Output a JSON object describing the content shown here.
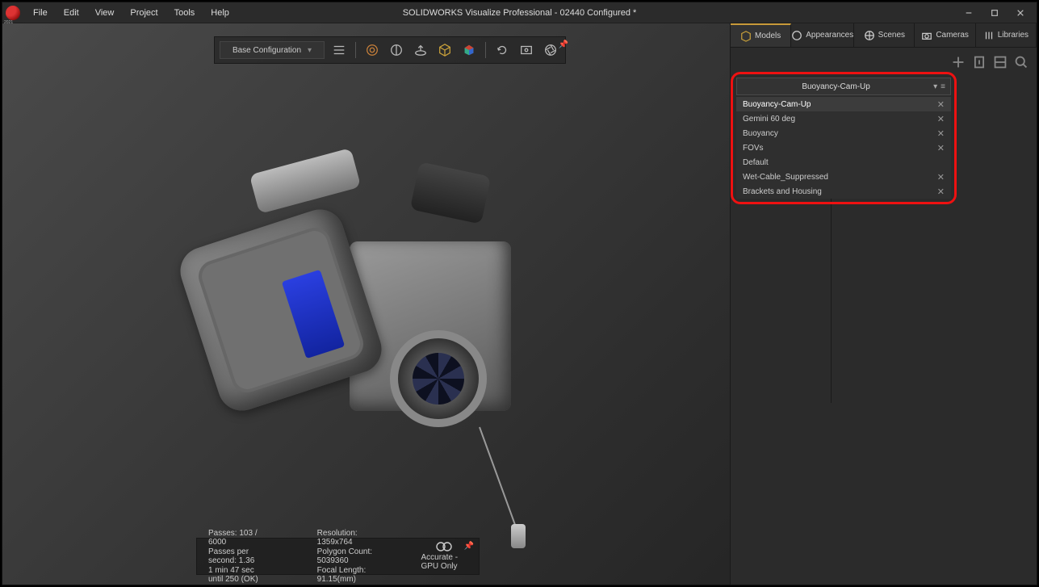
{
  "window": {
    "title": "SOLIDWORKS Visualize Professional - 02440 Configured *"
  },
  "menu": {
    "file": "File",
    "edit": "Edit",
    "view": "View",
    "project": "Project",
    "tools": "Tools",
    "help": "Help"
  },
  "config_dropdown": {
    "label": "Base Configuration"
  },
  "status": {
    "passes": "Passes: 103 /  6000",
    "pps": "Passes per second: 1.36",
    "eta": "1 min 47 sec until 250 (OK)",
    "resolution": "Resolution: 1359x764",
    "polys": "Polygon Count: 5039360",
    "focal": "Focal Length: 91.15(mm)",
    "render_mode": "Accurate - GPU Only"
  },
  "panel_tabs": {
    "models": "Models",
    "appearances": "Appearances",
    "scenes": "Scenes",
    "cameras": "Cameras",
    "libraries": "Libraries"
  },
  "modelset": {
    "selected": "Buoyancy-Cam-Up",
    "items": [
      {
        "label": "Buoyancy-Cam-Up",
        "closable": true,
        "selected": true
      },
      {
        "label": "Gemini 60 deg",
        "closable": true
      },
      {
        "label": "Buoyancy",
        "closable": true
      },
      {
        "label": "FOVs",
        "closable": true
      },
      {
        "label": "Default",
        "closable": false
      },
      {
        "label": "Wet-Cable_Suppressed",
        "closable": true
      },
      {
        "label": "Brackets and Housing",
        "closable": true
      }
    ]
  }
}
